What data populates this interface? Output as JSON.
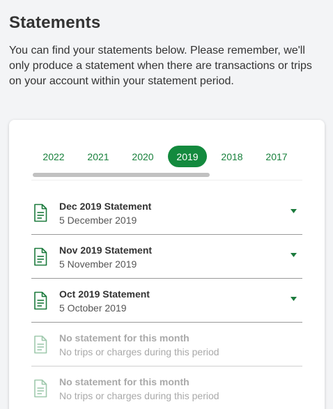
{
  "page": {
    "title": "Statements",
    "intro": "You can find your statements below. Please remember, we'll only produce a statement when there are transactions or trips on your account within your statement period."
  },
  "years": [
    "2022",
    "2021",
    "2020",
    "2019",
    "2018",
    "2017"
  ],
  "selected_year": "2019",
  "scroll_position": 0.6,
  "statements": [
    {
      "title": "Dec 2019 Statement",
      "date": "5 December 2019",
      "available": true
    },
    {
      "title": "Nov 2019 Statement",
      "date": "5 November 2019",
      "available": true
    },
    {
      "title": "Oct 2019 Statement",
      "date": "5 October 2019",
      "available": true
    },
    {
      "title": "No statement for this month",
      "date": "No trips or charges during this period",
      "available": false
    },
    {
      "title": "No statement for this month",
      "date": "No trips or charges during this period",
      "available": false
    }
  ],
  "colors": {
    "accent": "#138a3e",
    "accent_text": "#17803b",
    "icon_active": "#1b7a3c",
    "icon_disabled": "#9fc9ad",
    "disabled_text": "#a9a9a9"
  },
  "icons": {
    "statement": "document-icon",
    "expand": "caret-down-icon"
  }
}
